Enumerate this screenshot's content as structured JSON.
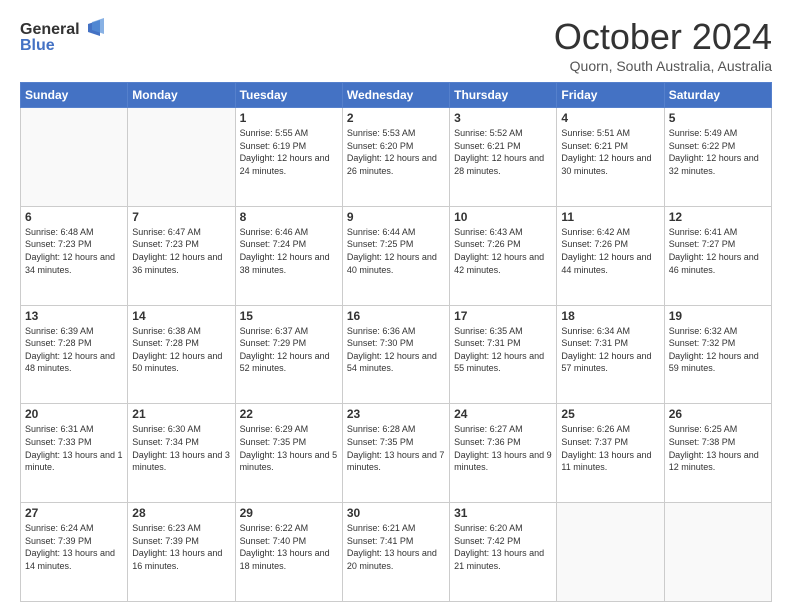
{
  "header": {
    "logo_line1": "General",
    "logo_line2": "Blue",
    "month": "October 2024",
    "location": "Quorn, South Australia, Australia"
  },
  "days_of_week": [
    "Sunday",
    "Monday",
    "Tuesday",
    "Wednesday",
    "Thursday",
    "Friday",
    "Saturday"
  ],
  "weeks": [
    [
      {
        "day": "",
        "sunrise": "",
        "sunset": "",
        "daylight": ""
      },
      {
        "day": "",
        "sunrise": "",
        "sunset": "",
        "daylight": ""
      },
      {
        "day": "1",
        "sunrise": "Sunrise: 5:55 AM",
        "sunset": "Sunset: 6:19 PM",
        "daylight": "Daylight: 12 hours and 24 minutes."
      },
      {
        "day": "2",
        "sunrise": "Sunrise: 5:53 AM",
        "sunset": "Sunset: 6:20 PM",
        "daylight": "Daylight: 12 hours and 26 minutes."
      },
      {
        "day": "3",
        "sunrise": "Sunrise: 5:52 AM",
        "sunset": "Sunset: 6:21 PM",
        "daylight": "Daylight: 12 hours and 28 minutes."
      },
      {
        "day": "4",
        "sunrise": "Sunrise: 5:51 AM",
        "sunset": "Sunset: 6:21 PM",
        "daylight": "Daylight: 12 hours and 30 minutes."
      },
      {
        "day": "5",
        "sunrise": "Sunrise: 5:49 AM",
        "sunset": "Sunset: 6:22 PM",
        "daylight": "Daylight: 12 hours and 32 minutes."
      }
    ],
    [
      {
        "day": "6",
        "sunrise": "Sunrise: 6:48 AM",
        "sunset": "Sunset: 7:23 PM",
        "daylight": "Daylight: 12 hours and 34 minutes."
      },
      {
        "day": "7",
        "sunrise": "Sunrise: 6:47 AM",
        "sunset": "Sunset: 7:23 PM",
        "daylight": "Daylight: 12 hours and 36 minutes."
      },
      {
        "day": "8",
        "sunrise": "Sunrise: 6:46 AM",
        "sunset": "Sunset: 7:24 PM",
        "daylight": "Daylight: 12 hours and 38 minutes."
      },
      {
        "day": "9",
        "sunrise": "Sunrise: 6:44 AM",
        "sunset": "Sunset: 7:25 PM",
        "daylight": "Daylight: 12 hours and 40 minutes."
      },
      {
        "day": "10",
        "sunrise": "Sunrise: 6:43 AM",
        "sunset": "Sunset: 7:26 PM",
        "daylight": "Daylight: 12 hours and 42 minutes."
      },
      {
        "day": "11",
        "sunrise": "Sunrise: 6:42 AM",
        "sunset": "Sunset: 7:26 PM",
        "daylight": "Daylight: 12 hours and 44 minutes."
      },
      {
        "day": "12",
        "sunrise": "Sunrise: 6:41 AM",
        "sunset": "Sunset: 7:27 PM",
        "daylight": "Daylight: 12 hours and 46 minutes."
      }
    ],
    [
      {
        "day": "13",
        "sunrise": "Sunrise: 6:39 AM",
        "sunset": "Sunset: 7:28 PM",
        "daylight": "Daylight: 12 hours and 48 minutes."
      },
      {
        "day": "14",
        "sunrise": "Sunrise: 6:38 AM",
        "sunset": "Sunset: 7:28 PM",
        "daylight": "Daylight: 12 hours and 50 minutes."
      },
      {
        "day": "15",
        "sunrise": "Sunrise: 6:37 AM",
        "sunset": "Sunset: 7:29 PM",
        "daylight": "Daylight: 12 hours and 52 minutes."
      },
      {
        "day": "16",
        "sunrise": "Sunrise: 6:36 AM",
        "sunset": "Sunset: 7:30 PM",
        "daylight": "Daylight: 12 hours and 54 minutes."
      },
      {
        "day": "17",
        "sunrise": "Sunrise: 6:35 AM",
        "sunset": "Sunset: 7:31 PM",
        "daylight": "Daylight: 12 hours and 55 minutes."
      },
      {
        "day": "18",
        "sunrise": "Sunrise: 6:34 AM",
        "sunset": "Sunset: 7:31 PM",
        "daylight": "Daylight: 12 hours and 57 minutes."
      },
      {
        "day": "19",
        "sunrise": "Sunrise: 6:32 AM",
        "sunset": "Sunset: 7:32 PM",
        "daylight": "Daylight: 12 hours and 59 minutes."
      }
    ],
    [
      {
        "day": "20",
        "sunrise": "Sunrise: 6:31 AM",
        "sunset": "Sunset: 7:33 PM",
        "daylight": "Daylight: 13 hours and 1 minute."
      },
      {
        "day": "21",
        "sunrise": "Sunrise: 6:30 AM",
        "sunset": "Sunset: 7:34 PM",
        "daylight": "Daylight: 13 hours and 3 minutes."
      },
      {
        "day": "22",
        "sunrise": "Sunrise: 6:29 AM",
        "sunset": "Sunset: 7:35 PM",
        "daylight": "Daylight: 13 hours and 5 minutes."
      },
      {
        "day": "23",
        "sunrise": "Sunrise: 6:28 AM",
        "sunset": "Sunset: 7:35 PM",
        "daylight": "Daylight: 13 hours and 7 minutes."
      },
      {
        "day": "24",
        "sunrise": "Sunrise: 6:27 AM",
        "sunset": "Sunset: 7:36 PM",
        "daylight": "Daylight: 13 hours and 9 minutes."
      },
      {
        "day": "25",
        "sunrise": "Sunrise: 6:26 AM",
        "sunset": "Sunset: 7:37 PM",
        "daylight": "Daylight: 13 hours and 11 minutes."
      },
      {
        "day": "26",
        "sunrise": "Sunrise: 6:25 AM",
        "sunset": "Sunset: 7:38 PM",
        "daylight": "Daylight: 13 hours and 12 minutes."
      }
    ],
    [
      {
        "day": "27",
        "sunrise": "Sunrise: 6:24 AM",
        "sunset": "Sunset: 7:39 PM",
        "daylight": "Daylight: 13 hours and 14 minutes."
      },
      {
        "day": "28",
        "sunrise": "Sunrise: 6:23 AM",
        "sunset": "Sunset: 7:39 PM",
        "daylight": "Daylight: 13 hours and 16 minutes."
      },
      {
        "day": "29",
        "sunrise": "Sunrise: 6:22 AM",
        "sunset": "Sunset: 7:40 PM",
        "daylight": "Daylight: 13 hours and 18 minutes."
      },
      {
        "day": "30",
        "sunrise": "Sunrise: 6:21 AM",
        "sunset": "Sunset: 7:41 PM",
        "daylight": "Daylight: 13 hours and 20 minutes."
      },
      {
        "day": "31",
        "sunrise": "Sunrise: 6:20 AM",
        "sunset": "Sunset: 7:42 PM",
        "daylight": "Daylight: 13 hours and 21 minutes."
      },
      {
        "day": "",
        "sunrise": "",
        "sunset": "",
        "daylight": ""
      },
      {
        "day": "",
        "sunrise": "",
        "sunset": "",
        "daylight": ""
      }
    ]
  ]
}
